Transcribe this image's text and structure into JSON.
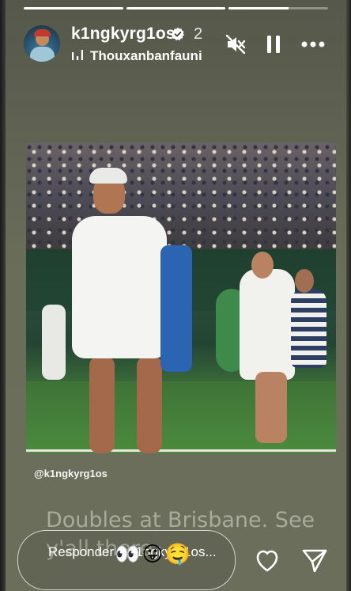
{
  "story": {
    "progress": [
      {
        "filled": 1.0
      },
      {
        "filled": 1.0
      },
      {
        "filled": 0.6
      }
    ]
  },
  "header": {
    "username": "k1ngkyrg1os",
    "time_ago": "2",
    "music_label": "Thouxanbanfauni",
    "icons": [
      "verified-badge-icon",
      "music-bars-icon",
      "mute-icon",
      "pause-icon",
      "more-icon"
    ]
  },
  "content": {
    "mention": "@k1ngkyrg1os",
    "caption": "Doubles at Brisbane. See y'all there"
  },
  "reply": {
    "placeholder": "Responder a k1ngkyrg1os...",
    "emojis": "👀😛🤤"
  },
  "footer": {
    "icons": [
      "heart-icon",
      "send-icon"
    ]
  }
}
